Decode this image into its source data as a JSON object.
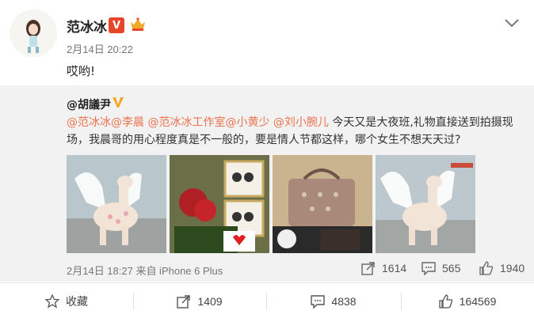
{
  "post": {
    "author": "范冰冰",
    "verified_mark": "V",
    "timestamp": "2月14日 20:22",
    "text": "哎哟!"
  },
  "repost": {
    "author": "@胡議尹",
    "mentions": [
      "@范冰冰",
      "@李晨",
      "@范冰冰工作室",
      "@小黄少",
      "@刘小腕儿"
    ],
    "text": "今天又是大夜班,礼物直接送到拍摄现场，我晨哥的用心程度真是不一般的，要是情人节都这样，哪个女生不想天天过?",
    "meta": "2月14日 18:27 来自 iPhone 6 Plus",
    "stats": {
      "reposts": "1614",
      "comments": "565",
      "likes": "1940"
    },
    "photos": [
      "wing-llama-flower-sculpture",
      "roses-gift-box-heart",
      "handbag-gifts",
      "wing-llama-flower-sculpture"
    ]
  },
  "actions": {
    "favorite": "收藏",
    "reposts": "1409",
    "comments": "4838",
    "likes": "164569"
  },
  "colors": {
    "link": "#eb7350",
    "badge_red": "#e8462b",
    "badge_gold": "#f0a92b"
  }
}
